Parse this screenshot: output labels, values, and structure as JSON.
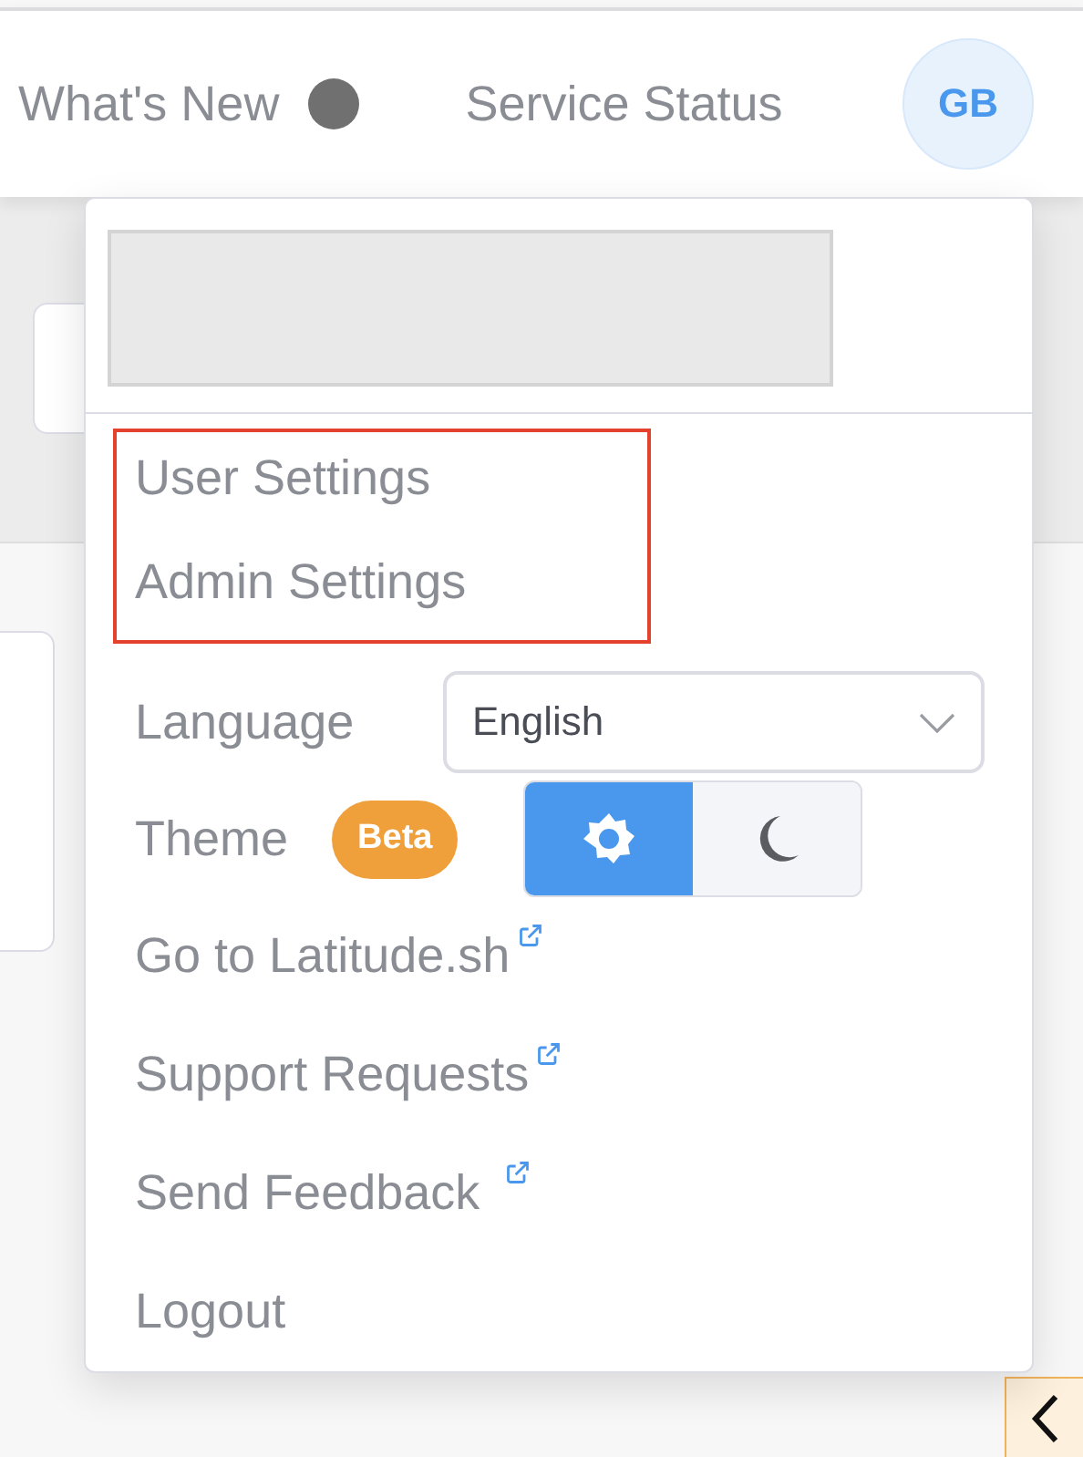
{
  "header": {
    "links": [
      "What's New",
      "Service Status"
    ],
    "avatar": "GB"
  },
  "user_menu": {
    "highlighted_links": [
      "User Settings",
      "Admin Settings"
    ],
    "language": {
      "label": "Language",
      "value": "English"
    },
    "theme": {
      "label": "Theme",
      "badge": "Beta",
      "options": [
        {
          "kind": "light",
          "selected": true
        },
        {
          "kind": "dark",
          "selected": false
        }
      ]
    },
    "links": [
      {
        "label": "Go to Latitude.sh",
        "external": true
      },
      {
        "label": "Support Requests",
        "external": true
      },
      {
        "label": "Send Feedback",
        "external": true
      },
      {
        "label": "Logout",
        "external": false
      }
    ]
  }
}
